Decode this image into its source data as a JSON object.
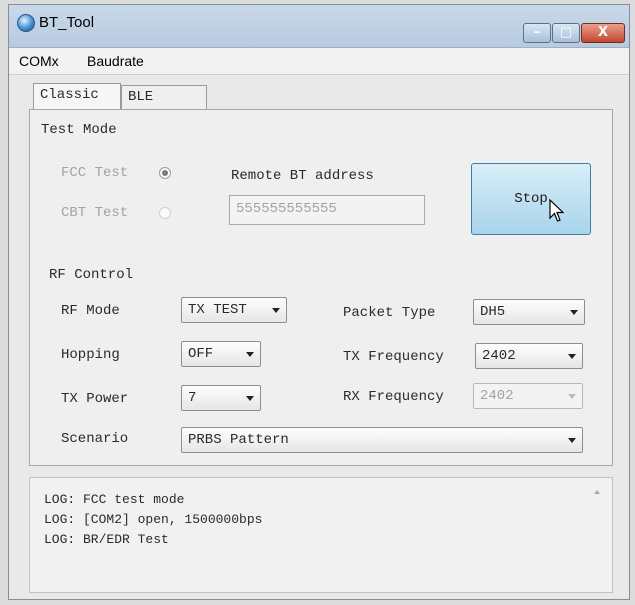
{
  "window": {
    "title": "BT_Tool",
    "controls": {
      "minimize": "–",
      "maximize": "□",
      "close": "X"
    }
  },
  "menu": [
    "COMx",
    "Baudrate"
  ],
  "tabs": [
    {
      "label": "Classic",
      "active": true
    },
    {
      "label": "BLE",
      "active": false
    }
  ],
  "test_mode": {
    "heading": "Test Mode",
    "fcc_label": "FCC Test",
    "fcc_checked": true,
    "cbt_label": "CBT Test",
    "cbt_enabled": false,
    "remote_label": "Remote BT address",
    "remote_value": "555555555555",
    "stop_label": "Stop"
  },
  "rf_control": {
    "heading": "RF Control",
    "rf_mode_label": "RF Mode",
    "rf_mode_value": "TX TEST",
    "hopping_label": "Hopping",
    "hopping_value": "OFF",
    "tx_power_label": "TX Power",
    "tx_power_value": "7",
    "scenario_label": "Scenario",
    "scenario_value": "PRBS Pattern",
    "packet_type_label": "Packet Type",
    "packet_type_value": "DH5",
    "tx_freq_label": "TX Frequency",
    "tx_freq_value": "2402",
    "rx_freq_label": "RX Frequency",
    "rx_freq_value": "2402"
  },
  "log": [
    "LOG: FCC test mode",
    "LOG: [COM2] open, 1500000bps",
    "LOG: BR/EDR Test"
  ],
  "colors": {
    "titlebar": "#c9d9ea",
    "stop_button": "#a8d4ea",
    "close_button": "#c4482d"
  },
  "icons": [
    "app-icon",
    "mouse-cursor-icon",
    "dropdown-arrow-icon"
  ]
}
